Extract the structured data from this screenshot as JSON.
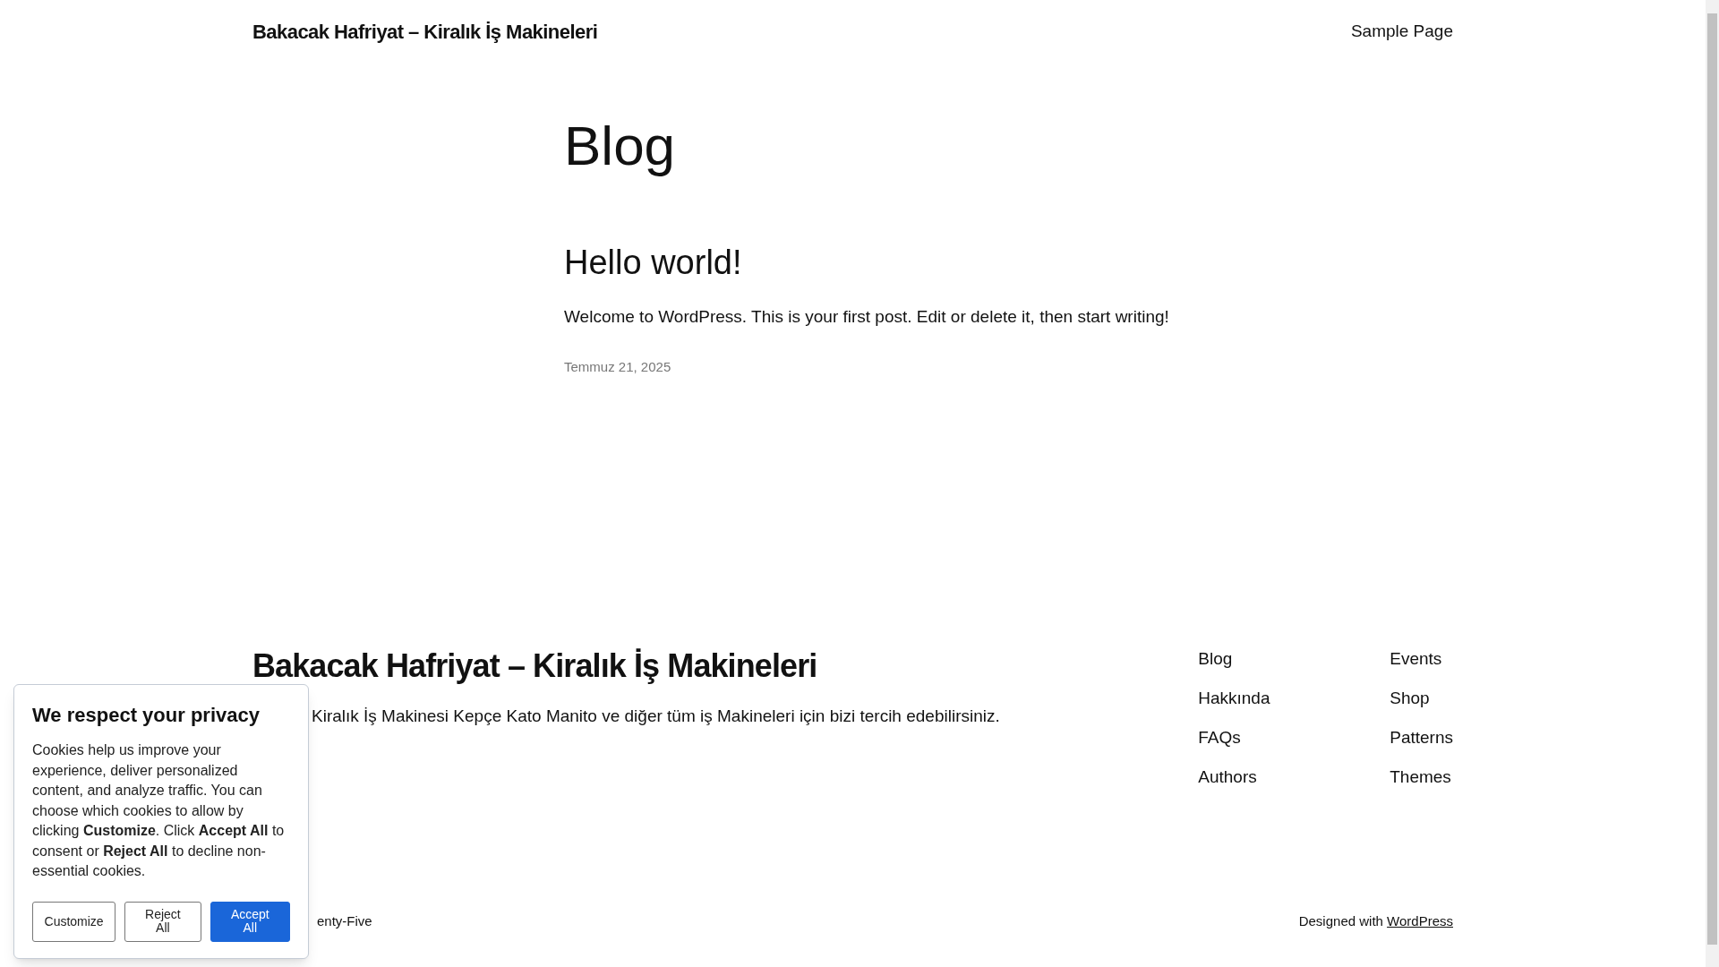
{
  "header": {
    "site_title": "Bakacak Hafriyat – Kiralık İş Makineleri",
    "nav": [
      "Sample Page"
    ]
  },
  "page_title": "Blog",
  "posts": [
    {
      "title": "Hello world!",
      "excerpt": "Welcome to WordPress. This is your first post. Edit or delete it, then start writing!",
      "date": "Temmuz 21, 2025"
    }
  ],
  "footer": {
    "site_title": "Bakacak Hafriyat – Kiralık İş Makineleri",
    "tagline": "Kiralık İş Makinesi Kepçe Kato Manito ve diğer tüm iş Makineleri için bizi tercih edebilirsiniz.",
    "nav_columns": [
      [
        "Blog",
        "Hakkında",
        "FAQs",
        "Authors"
      ],
      [
        "Events",
        "Shop",
        "Patterns",
        "Themes"
      ]
    ],
    "theme_credit": "enty-Five",
    "credit_prefix": "Designed with",
    "credit_link": "WordPress"
  },
  "cookie_banner": {
    "title": "We respect your privacy",
    "text": "Cookies help us improve your experience, deliver personalized content, and analyze traffic. You can choose which cookies to allow by clicking **Customize**. Click **Accept All** to consent or **Reject All** to decline non-essential cookies.",
    "buttons": [
      {
        "label": "Customize",
        "kind": "outline"
      },
      {
        "label": "Reject All",
        "kind": "outline"
      },
      {
        "label": "Accept All",
        "kind": "primary"
      }
    ]
  }
}
